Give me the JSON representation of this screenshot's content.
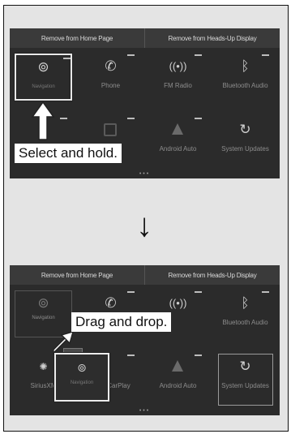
{
  "screen1": {
    "header": {
      "left": "Remove from Home Page",
      "right": "Remove from Heads-Up Display"
    },
    "tiles": [
      {
        "icon": "navigation-icon",
        "label": "Navigation"
      },
      {
        "icon": "phone-icon",
        "label": "Phone"
      },
      {
        "icon": "fm-radio-icon",
        "label": "FM Radio"
      },
      {
        "icon": "bluetooth-icon",
        "label": "Bluetooth Audio"
      },
      {
        "icon": "app-icon",
        "label": ""
      },
      {
        "icon": "android-auto-icon",
        "label": "Android Auto"
      },
      {
        "icon": "system-updates-icon",
        "label": "System Updates"
      }
    ],
    "callout": "Select and hold."
  },
  "screen2": {
    "header": {
      "left": "Remove from Home Page",
      "right": "Remove from Heads-Up Display"
    },
    "tiles": [
      {
        "icon": "navigation-icon",
        "label": "Navigation"
      },
      {
        "icon": "phone-icon",
        "label": ""
      },
      {
        "icon": "fm-radio-icon",
        "label": ""
      },
      {
        "icon": "bluetooth-icon",
        "label": "Bluetooth Audio"
      },
      {
        "icon": "siriusxm-icon",
        "label": "SiriusXM"
      },
      {
        "icon": "carplay-icon",
        "label": "CarPlay"
      },
      {
        "icon": "android-auto-icon",
        "label": "Android Auto"
      },
      {
        "icon": "system-updates-icon",
        "label": "System Updates"
      }
    ],
    "dragged": {
      "icon": "navigation-icon",
      "label": "Navigation"
    },
    "callout": "Drag and drop."
  },
  "step_arrow": "↓",
  "page_dots": "•••",
  "colors": {
    "screen_bg": "#2b2b2b",
    "header_bg": "#3a3a3a",
    "frame_bg": "#e4e4e4",
    "highlight": "#ececec"
  }
}
